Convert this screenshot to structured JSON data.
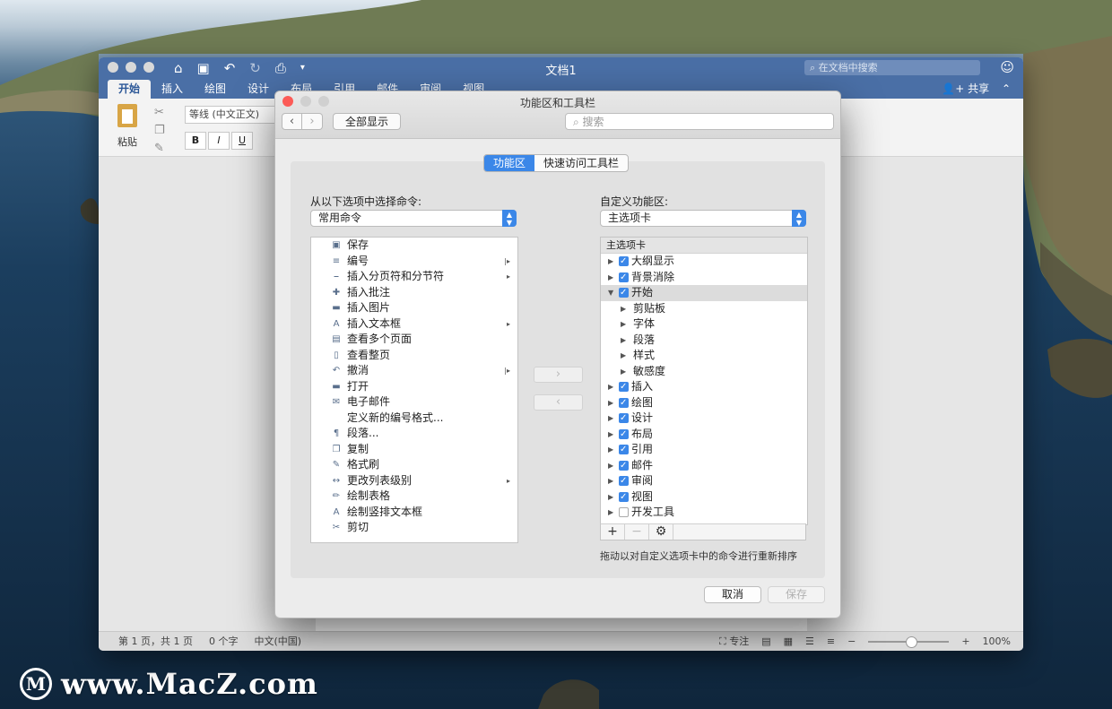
{
  "watermark": {
    "logo_letter": "M",
    "text": "www.MacZ.com"
  },
  "word": {
    "title": "文档1",
    "search_placeholder": "在文档中搜索",
    "tabs": [
      "开始",
      "插入",
      "绘图",
      "设计",
      "布局",
      "引用",
      "邮件",
      "审阅",
      "视图"
    ],
    "share_label": "共享",
    "paste_label": "粘贴",
    "font_name": "等线 (中文正文)",
    "format_buttons": [
      "B",
      "I",
      "U"
    ],
    "status": {
      "page": "第 1 页，共 1 页",
      "words": "0 个字",
      "language": "中文(中国)",
      "focus": "专注",
      "zoom": "100%"
    }
  },
  "dialog": {
    "title": "功能区和工具栏",
    "show_all": "全部显示",
    "search_placeholder": "搜索",
    "segments": [
      "功能区",
      "快速访问工具栏"
    ],
    "left_label": "从以下选项中选择命令:",
    "left_select": "常用命令",
    "right_label": "自定义功能区:",
    "right_select": "主选项卡",
    "commands": [
      {
        "icon": "save-icon",
        "glyph": "▣",
        "label": "保存"
      },
      {
        "icon": "numbering-icon",
        "glyph": "≡",
        "label": "编号",
        "sub": "split"
      },
      {
        "icon": "page-break-icon",
        "glyph": "⎯",
        "label": "插入分页符和分节符",
        "sub": "arrow"
      },
      {
        "icon": "comment-icon",
        "glyph": "✚",
        "label": "插入批注"
      },
      {
        "icon": "picture-icon",
        "glyph": "▬",
        "label": "插入图片"
      },
      {
        "icon": "textbox-icon",
        "glyph": "A",
        "label": "插入文本框",
        "sub": "arrow"
      },
      {
        "icon": "multi-page-icon",
        "glyph": "▤",
        "label": "查看多个页面"
      },
      {
        "icon": "one-page-icon",
        "glyph": "▯",
        "label": "查看整页"
      },
      {
        "icon": "undo-icon",
        "glyph": "↶",
        "label": "撤消",
        "sub": "split"
      },
      {
        "icon": "folder-icon",
        "glyph": "▬",
        "label": "打开"
      },
      {
        "icon": "email-icon",
        "glyph": "✉",
        "label": "电子邮件"
      },
      {
        "icon": "",
        "glyph": "",
        "label": "定义新的编号格式..."
      },
      {
        "icon": "paragraph-icon",
        "glyph": "¶",
        "label": "段落..."
      },
      {
        "icon": "copy-icon",
        "glyph": "❐",
        "label": "复制"
      },
      {
        "icon": "format-painter-icon",
        "glyph": "✎",
        "label": "格式刷"
      },
      {
        "icon": "list-level-icon",
        "glyph": "↔",
        "label": "更改列表级别",
        "sub": "arrow"
      },
      {
        "icon": "draw-table-icon",
        "glyph": "✏",
        "label": "绘制表格"
      },
      {
        "icon": "vertical-textbox-icon",
        "glyph": "A",
        "label": "绘制竖排文本框"
      },
      {
        "icon": "cut-icon",
        "glyph": "✂",
        "label": "剪切"
      }
    ],
    "tree_header": "主选项卡",
    "tree": [
      {
        "label": "大纲显示",
        "level": 0,
        "checked": true,
        "expanded": false
      },
      {
        "label": "背景消除",
        "level": 0,
        "checked": true,
        "expanded": false
      },
      {
        "label": "开始",
        "level": 0,
        "checked": true,
        "expanded": true,
        "selected": true
      },
      {
        "label": "剪贴板",
        "level": 1
      },
      {
        "label": "字体",
        "level": 1
      },
      {
        "label": "段落",
        "level": 1
      },
      {
        "label": "样式",
        "level": 1
      },
      {
        "label": "敏感度",
        "level": 1
      },
      {
        "label": "插入",
        "level": 0,
        "checked": true,
        "expanded": false
      },
      {
        "label": "绘图",
        "level": 0,
        "checked": true,
        "expanded": false
      },
      {
        "label": "设计",
        "level": 0,
        "checked": true,
        "expanded": false
      },
      {
        "label": "布局",
        "level": 0,
        "checked": true,
        "expanded": false
      },
      {
        "label": "引用",
        "level": 0,
        "checked": true,
        "expanded": false
      },
      {
        "label": "邮件",
        "level": 0,
        "checked": true,
        "expanded": false
      },
      {
        "label": "审阅",
        "level": 0,
        "checked": true,
        "expanded": false
      },
      {
        "label": "视图",
        "level": 0,
        "checked": true,
        "expanded": false
      },
      {
        "label": "开发工具",
        "level": 0,
        "checked": false,
        "expanded": false
      }
    ],
    "tree_buttons": [
      "+",
      "−",
      "⚙"
    ],
    "hint": "拖动以对自定义选项卡中的命令进行重新排序",
    "cancel": "取消",
    "save": "保存"
  }
}
